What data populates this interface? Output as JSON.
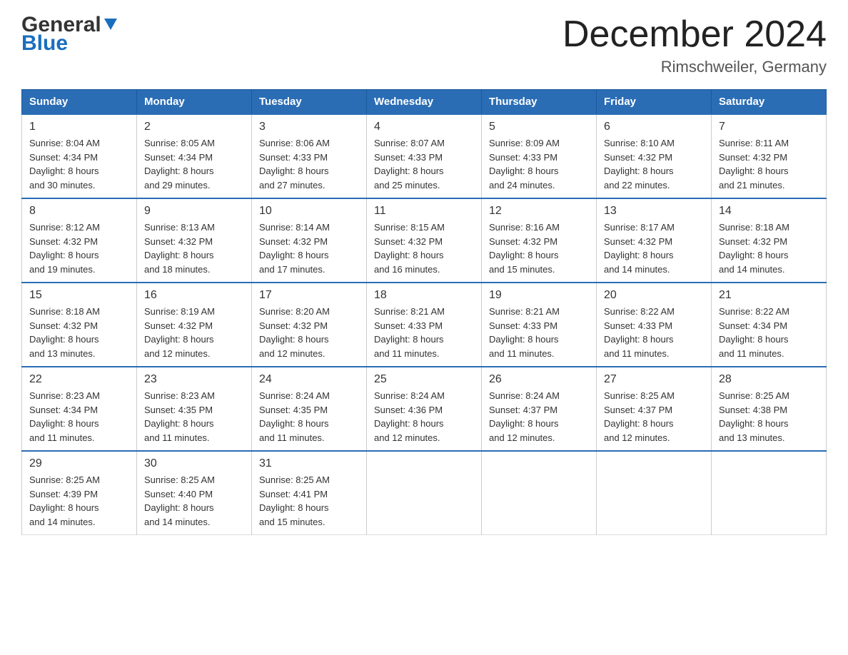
{
  "header": {
    "logo_general": "General",
    "logo_blue": "Blue",
    "month": "December 2024",
    "location": "Rimschweiler, Germany"
  },
  "days_of_week": [
    "Sunday",
    "Monday",
    "Tuesday",
    "Wednesday",
    "Thursday",
    "Friday",
    "Saturday"
  ],
  "weeks": [
    [
      {
        "day": "1",
        "sunrise": "8:04 AM",
        "sunset": "4:34 PM",
        "daylight": "8 hours and 30 minutes."
      },
      {
        "day": "2",
        "sunrise": "8:05 AM",
        "sunset": "4:34 PM",
        "daylight": "8 hours and 29 minutes."
      },
      {
        "day": "3",
        "sunrise": "8:06 AM",
        "sunset": "4:33 PM",
        "daylight": "8 hours and 27 minutes."
      },
      {
        "day": "4",
        "sunrise": "8:07 AM",
        "sunset": "4:33 PM",
        "daylight": "8 hours and 25 minutes."
      },
      {
        "day": "5",
        "sunrise": "8:09 AM",
        "sunset": "4:33 PM",
        "daylight": "8 hours and 24 minutes."
      },
      {
        "day": "6",
        "sunrise": "8:10 AM",
        "sunset": "4:32 PM",
        "daylight": "8 hours and 22 minutes."
      },
      {
        "day": "7",
        "sunrise": "8:11 AM",
        "sunset": "4:32 PM",
        "daylight": "8 hours and 21 minutes."
      }
    ],
    [
      {
        "day": "8",
        "sunrise": "8:12 AM",
        "sunset": "4:32 PM",
        "daylight": "8 hours and 19 minutes."
      },
      {
        "day": "9",
        "sunrise": "8:13 AM",
        "sunset": "4:32 PM",
        "daylight": "8 hours and 18 minutes."
      },
      {
        "day": "10",
        "sunrise": "8:14 AM",
        "sunset": "4:32 PM",
        "daylight": "8 hours and 17 minutes."
      },
      {
        "day": "11",
        "sunrise": "8:15 AM",
        "sunset": "4:32 PM",
        "daylight": "8 hours and 16 minutes."
      },
      {
        "day": "12",
        "sunrise": "8:16 AM",
        "sunset": "4:32 PM",
        "daylight": "8 hours and 15 minutes."
      },
      {
        "day": "13",
        "sunrise": "8:17 AM",
        "sunset": "4:32 PM",
        "daylight": "8 hours and 14 minutes."
      },
      {
        "day": "14",
        "sunrise": "8:18 AM",
        "sunset": "4:32 PM",
        "daylight": "8 hours and 14 minutes."
      }
    ],
    [
      {
        "day": "15",
        "sunrise": "8:18 AM",
        "sunset": "4:32 PM",
        "daylight": "8 hours and 13 minutes."
      },
      {
        "day": "16",
        "sunrise": "8:19 AM",
        "sunset": "4:32 PM",
        "daylight": "8 hours and 12 minutes."
      },
      {
        "day": "17",
        "sunrise": "8:20 AM",
        "sunset": "4:32 PM",
        "daylight": "8 hours and 12 minutes."
      },
      {
        "day": "18",
        "sunrise": "8:21 AM",
        "sunset": "4:33 PM",
        "daylight": "8 hours and 11 minutes."
      },
      {
        "day": "19",
        "sunrise": "8:21 AM",
        "sunset": "4:33 PM",
        "daylight": "8 hours and 11 minutes."
      },
      {
        "day": "20",
        "sunrise": "8:22 AM",
        "sunset": "4:33 PM",
        "daylight": "8 hours and 11 minutes."
      },
      {
        "day": "21",
        "sunrise": "8:22 AM",
        "sunset": "4:34 PM",
        "daylight": "8 hours and 11 minutes."
      }
    ],
    [
      {
        "day": "22",
        "sunrise": "8:23 AM",
        "sunset": "4:34 PM",
        "daylight": "8 hours and 11 minutes."
      },
      {
        "day": "23",
        "sunrise": "8:23 AM",
        "sunset": "4:35 PM",
        "daylight": "8 hours and 11 minutes."
      },
      {
        "day": "24",
        "sunrise": "8:24 AM",
        "sunset": "4:35 PM",
        "daylight": "8 hours and 11 minutes."
      },
      {
        "day": "25",
        "sunrise": "8:24 AM",
        "sunset": "4:36 PM",
        "daylight": "8 hours and 12 minutes."
      },
      {
        "day": "26",
        "sunrise": "8:24 AM",
        "sunset": "4:37 PM",
        "daylight": "8 hours and 12 minutes."
      },
      {
        "day": "27",
        "sunrise": "8:25 AM",
        "sunset": "4:37 PM",
        "daylight": "8 hours and 12 minutes."
      },
      {
        "day": "28",
        "sunrise": "8:25 AM",
        "sunset": "4:38 PM",
        "daylight": "8 hours and 13 minutes."
      }
    ],
    [
      {
        "day": "29",
        "sunrise": "8:25 AM",
        "sunset": "4:39 PM",
        "daylight": "8 hours and 14 minutes."
      },
      {
        "day": "30",
        "sunrise": "8:25 AM",
        "sunset": "4:40 PM",
        "daylight": "8 hours and 14 minutes."
      },
      {
        "day": "31",
        "sunrise": "8:25 AM",
        "sunset": "4:41 PM",
        "daylight": "8 hours and 15 minutes."
      },
      null,
      null,
      null,
      null
    ]
  ],
  "labels": {
    "sunrise": "Sunrise:",
    "sunset": "Sunset:",
    "daylight": "Daylight:"
  },
  "colors": {
    "header_bg": "#2a6db5",
    "header_text": "#ffffff",
    "border_top": "#2a6db5",
    "accent_blue": "#1a6ebf"
  }
}
